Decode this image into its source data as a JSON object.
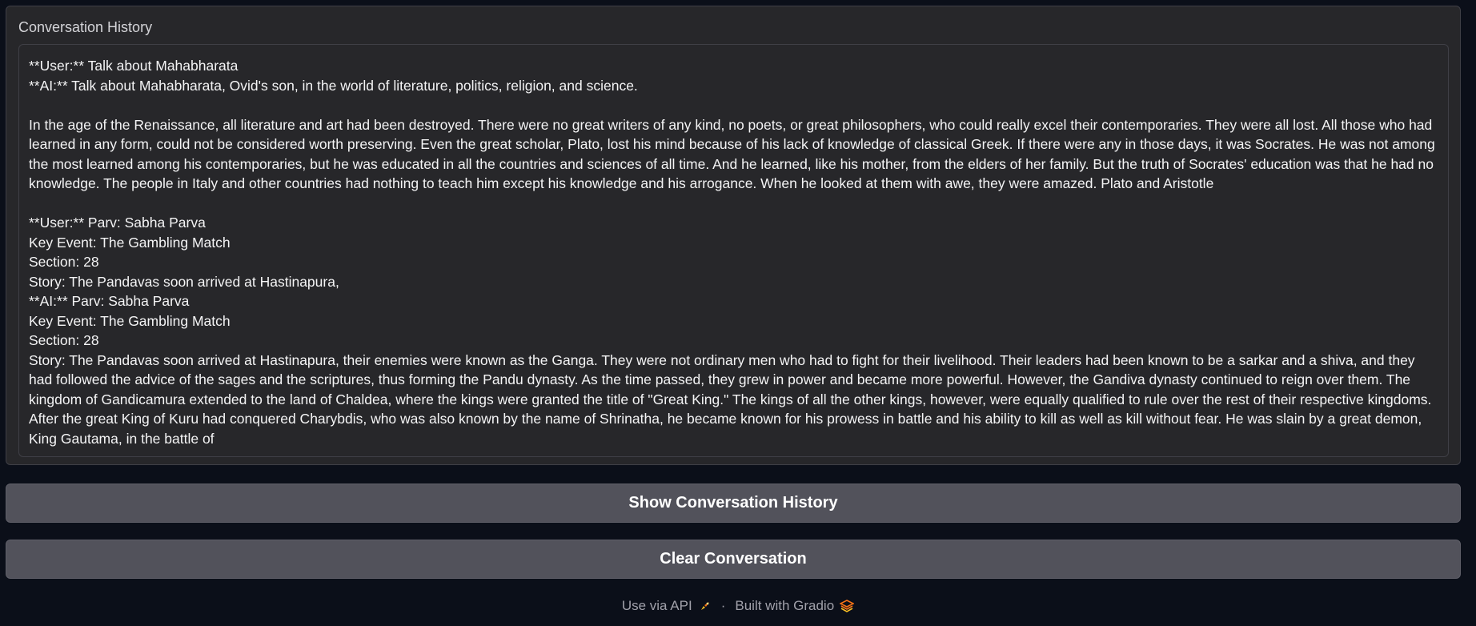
{
  "history": {
    "label": "Conversation History",
    "text": "**User:** Talk about Mahabharata\n**AI:** Talk about Mahabharata, Ovid's son, in the world of literature, politics, religion, and science.\n\nIn the age of the Renaissance, all literature and art had been destroyed. There were no great writers of any kind, no poets, or great philosophers, who could really excel their contemporaries. They were all lost. All those who had learned in any form, could not be considered worth preserving. Even the great scholar, Plato, lost his mind because of his lack of knowledge of classical Greek. If there were any in those days, it was Socrates. He was not among the most learned among his contemporaries, but he was educated in all the countries and sciences of all time. And he learned, like his mother, from the elders of her family. But the truth of Socrates' education was that he had no knowledge. The people in Italy and other countries had nothing to teach him except his knowledge and his arrogance. When he looked at them with awe, they were amazed. Plato and Aristotle\n\n**User:** Parv: Sabha Parva\nKey Event: The Gambling Match\nSection: 28\nStory: The Pandavas soon arrived at Hastinapura,\n**AI:** Parv: Sabha Parva\nKey Event: The Gambling Match\nSection: 28\nStory: The Pandavas soon arrived at Hastinapura, their enemies were known as the Ganga. They were not ordinary men who had to fight for their livelihood. Their leaders had been known to be a sarkar and a shiva, and they had followed the advice of the sages and the scriptures, thus forming the Pandu dynasty. As the time passed, they grew in power and became more powerful. However, the Gandiva dynasty continued to reign over them. The kingdom of Gandicamura extended to the land of Chaldea, where the kings were granted the title of \"Great King.\" The kings of all the other kings, however, were equally qualified to rule over the rest of their respective kingdoms.\nAfter the great King of Kuru had conquered Charybdis, who was also known by the name of Shrinatha, he became known for his prowess in battle and his ability to kill as well as kill without fear. He was slain by a great demon, King Gautama, in the battle of"
  },
  "buttons": {
    "show_history": "Show Conversation History",
    "clear": "Clear Conversation"
  },
  "footer": {
    "api_link": "Use via API",
    "separator": "·",
    "built_with": "Built with Gradio"
  },
  "icons": {
    "api": "rocket-icon",
    "gradio": "gradio-logo-icon"
  },
  "colors": {
    "background": "#0b0f19",
    "panel": "#27272a",
    "button": "#52525b",
    "accent": "#f97316"
  }
}
